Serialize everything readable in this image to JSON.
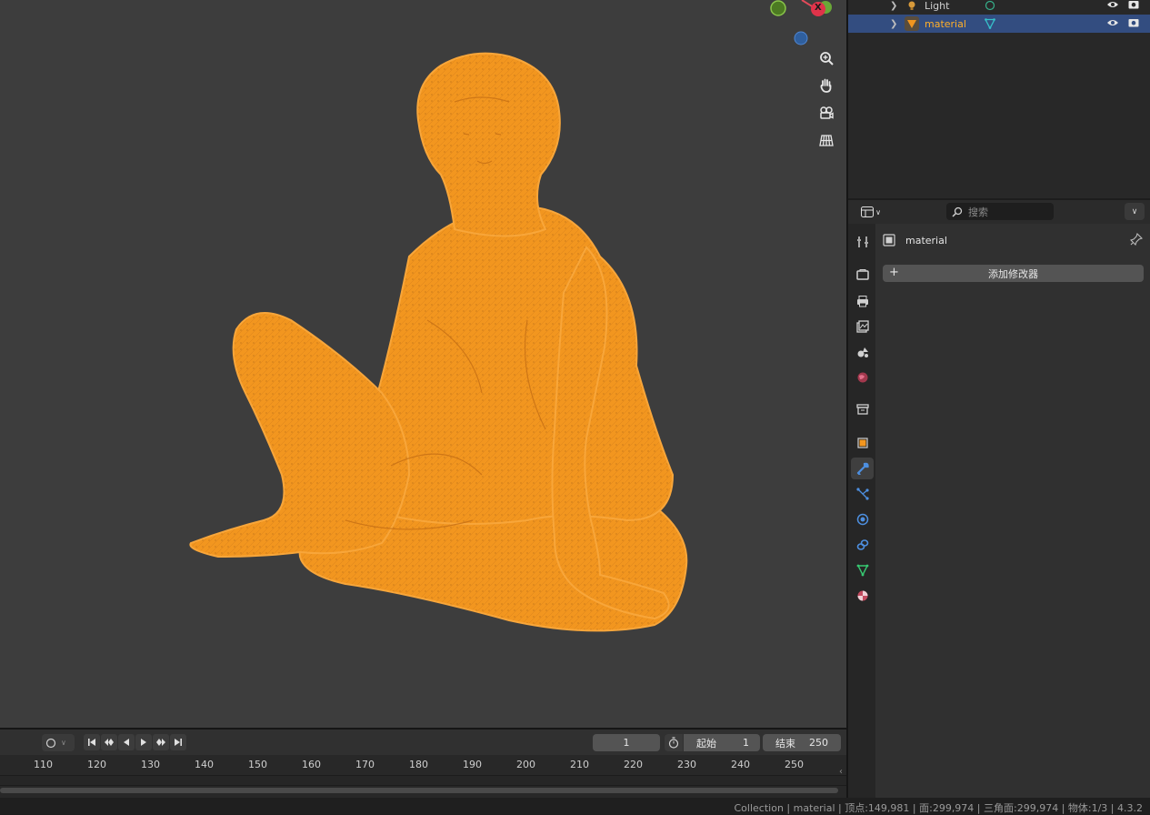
{
  "viewport": {
    "gizmo": {
      "x_label": "X"
    },
    "nav_tools": [
      "zoom-icon",
      "pan-hand-icon",
      "camera-view-icon",
      "ortho-grid-icon"
    ]
  },
  "outliner": {
    "rows": [
      {
        "label": "Light",
        "icon": "light-icon",
        "data_icon": "light-data-icon",
        "selected": false
      },
      {
        "label": "material",
        "icon": "mesh-object-icon",
        "data_icon": "mesh-data-icon",
        "selected": true
      }
    ]
  },
  "properties": {
    "search_placeholder": "搜索",
    "object_name": "material",
    "add_modifier_label": "添加修改器",
    "add_symbol": "+",
    "tabs": [
      "tool-icon",
      "render-icon",
      "output-icon",
      "view-layer-icon",
      "scene-icon",
      "world-icon",
      "collection-icon",
      "object-icon",
      "modifier-icon",
      "particles-icon",
      "physics-icon",
      "constraints-icon",
      "data-icon",
      "material-icon"
    ],
    "active_tab": "modifier-icon"
  },
  "timeline": {
    "current_frame": "1",
    "start_label": "起始",
    "start_value": "1",
    "end_label": "结束",
    "end_value": "250",
    "ticks": [
      "110",
      "120",
      "130",
      "140",
      "150",
      "160",
      "170",
      "180",
      "190",
      "200",
      "210",
      "220",
      "230",
      "240",
      "250"
    ]
  },
  "statusbar": {
    "text": "Collection | material | 顶点:149,981 | 面:299,974 | 三角面:299,974 | 物体:1/3 | 4.3.2"
  },
  "colors": {
    "accent_orange": "#f2961f",
    "selection_blue": "#334d80",
    "active_text_orange": "#ffaf29"
  }
}
